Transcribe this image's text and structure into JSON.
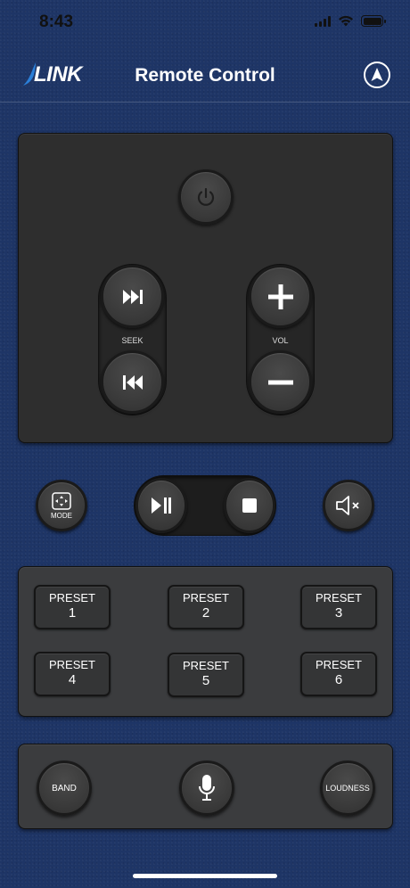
{
  "status_bar": {
    "time": "8:43"
  },
  "header": {
    "logo_text": "LINK",
    "title": "Remote Control"
  },
  "remote": {
    "seek_label": "SEEK",
    "vol_label": "VOL"
  },
  "transport": {
    "mode_label": "MODE"
  },
  "presets": [
    {
      "label": "PRESET",
      "number": "1"
    },
    {
      "label": "PRESET",
      "number": "2"
    },
    {
      "label": "PRESET",
      "number": "3"
    },
    {
      "label": "PRESET",
      "number": "4"
    },
    {
      "label": "PRESET",
      "number": "5"
    },
    {
      "label": "PRESET",
      "number": "6"
    }
  ],
  "bottom": {
    "band_label": "BAND",
    "loudness_label": "LOUDNESS"
  },
  "icons": {
    "power": "power-icon",
    "seek_forward": "skip-forward-icon",
    "seek_back": "skip-back-icon",
    "vol_up": "plus-icon",
    "vol_down": "minus-icon",
    "mode": "mode-icon",
    "play_pause": "play-pause-icon",
    "stop": "stop-icon",
    "mute": "mute-icon",
    "mic": "microphone-icon",
    "nav": "navigation-arrow-icon"
  },
  "colors": {
    "background": "#1e3566",
    "panel": "#343434",
    "accent": "#ffffff"
  }
}
